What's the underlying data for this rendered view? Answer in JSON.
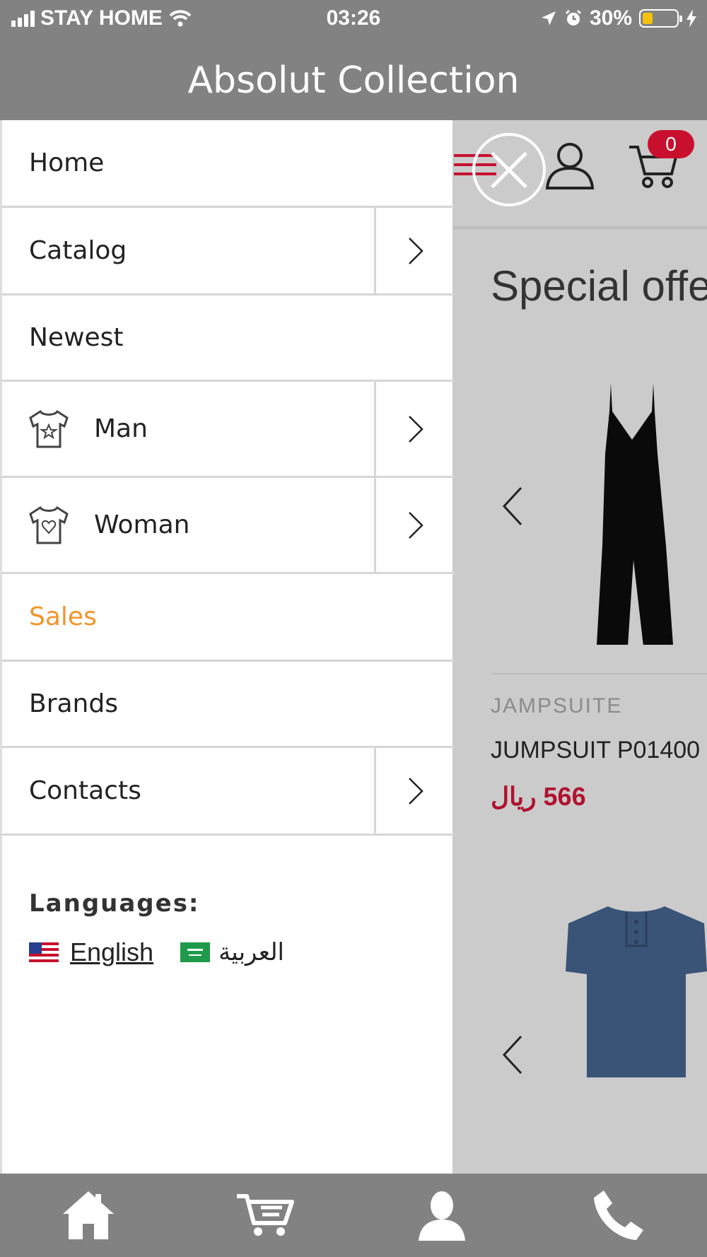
{
  "status_bar": {
    "carrier": "STAY HOME",
    "time": "03:26",
    "battery": "30%",
    "battery_level": 0.3
  },
  "app": {
    "title": "Absolut Collection"
  },
  "header": {
    "cart_count": "0"
  },
  "menu": {
    "items": [
      {
        "label": "Home"
      },
      {
        "label": "Catalog"
      },
      {
        "label": "Newest"
      },
      {
        "label": "Man",
        "icon": "tshirt-star-icon"
      },
      {
        "label": "Woman",
        "icon": "tshirt-heart-icon"
      },
      {
        "label": "Sales",
        "color": "#f0952c"
      },
      {
        "label": "Brands"
      },
      {
        "label": "Contacts"
      }
    ],
    "languages_title": "Languages:",
    "languages": [
      {
        "label": "English",
        "flag": "us-flag-icon"
      },
      {
        "label": "العربية",
        "flag": "sa-flag-icon"
      }
    ]
  },
  "content": {
    "section_title": "Special offe",
    "products": [
      {
        "category": "JAMPSUITE",
        "name": "JUMPSUIT P01400",
        "price": "566 ريال"
      }
    ]
  },
  "bottom_nav": {
    "icons": [
      "home-icon",
      "cart-icon",
      "user-icon",
      "phone-icon"
    ]
  },
  "colors": {
    "bar": "#828282",
    "accent": "#c8102e",
    "sales": "#f0952c"
  }
}
